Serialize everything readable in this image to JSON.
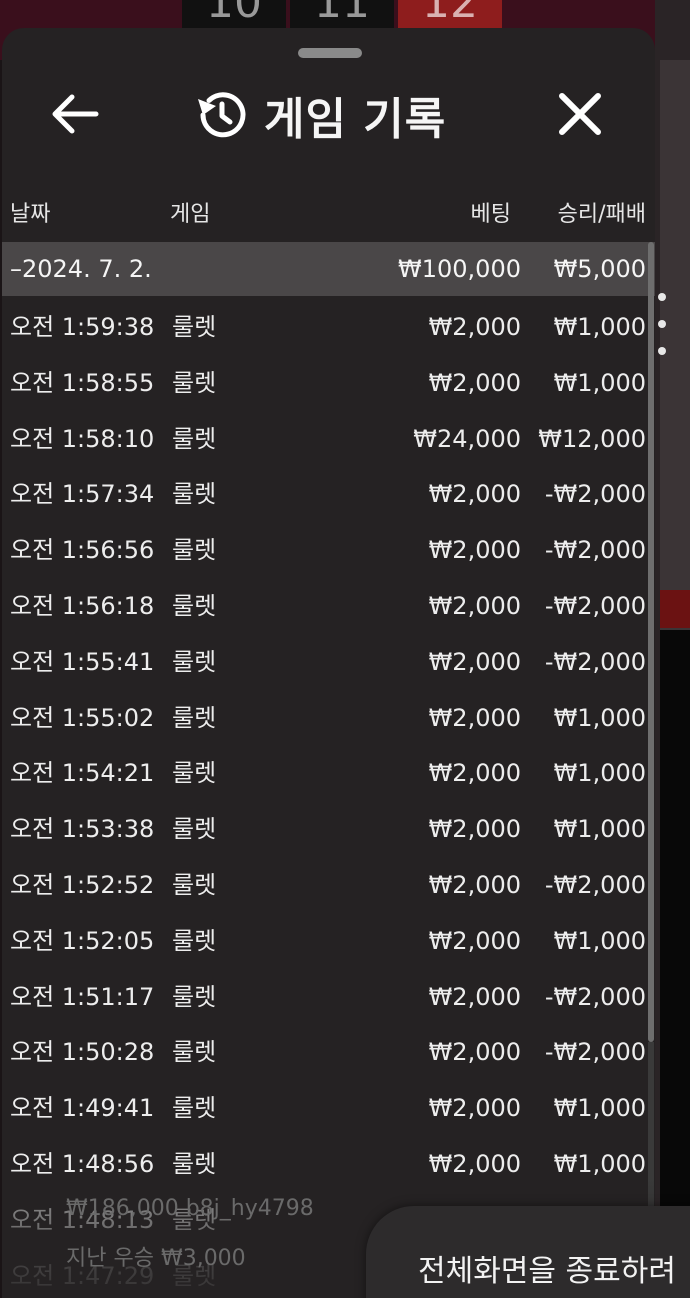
{
  "header": {
    "title": "게임 기록"
  },
  "columns": {
    "date": "날짜",
    "game": "게임",
    "bet": "베팅",
    "result": "승리/패배"
  },
  "summary": {
    "date": "–2024. 7. 2.",
    "bet": "₩100,000",
    "result": "₩5,000"
  },
  "rows": [
    {
      "time": "오전 1:59:38",
      "game": "룰렛",
      "bet": "₩2,000",
      "result": "₩1,000"
    },
    {
      "time": "오전 1:58:55",
      "game": "룰렛",
      "bet": "₩2,000",
      "result": "₩1,000"
    },
    {
      "time": "오전 1:58:10",
      "game": "룰렛",
      "bet": "₩24,000",
      "result": "₩12,000"
    },
    {
      "time": "오전 1:57:34",
      "game": "룰렛",
      "bet": "₩2,000",
      "result": "-₩2,000"
    },
    {
      "time": "오전 1:56:56",
      "game": "룰렛",
      "bet": "₩2,000",
      "result": "-₩2,000"
    },
    {
      "time": "오전 1:56:18",
      "game": "룰렛",
      "bet": "₩2,000",
      "result": "-₩2,000"
    },
    {
      "time": "오전 1:55:41",
      "game": "룰렛",
      "bet": "₩2,000",
      "result": "-₩2,000"
    },
    {
      "time": "오전 1:55:02",
      "game": "룰렛",
      "bet": "₩2,000",
      "result": "₩1,000"
    },
    {
      "time": "오전 1:54:21",
      "game": "룰렛",
      "bet": "₩2,000",
      "result": "₩1,000"
    },
    {
      "time": "오전 1:53:38",
      "game": "룰렛",
      "bet": "₩2,000",
      "result": "₩1,000"
    },
    {
      "time": "오전 1:52:52",
      "game": "룰렛",
      "bet": "₩2,000",
      "result": "-₩2,000"
    },
    {
      "time": "오전 1:52:05",
      "game": "룰렛",
      "bet": "₩2,000",
      "result": "₩1,000"
    },
    {
      "time": "오전 1:51:17",
      "game": "룰렛",
      "bet": "₩2,000",
      "result": "-₩2,000"
    },
    {
      "time": "오전 1:50:28",
      "game": "룰렛",
      "bet": "₩2,000",
      "result": "-₩2,000"
    },
    {
      "time": "오전 1:49:41",
      "game": "룰렛",
      "bet": "₩2,000",
      "result": "₩1,000"
    },
    {
      "time": "오전 1:48:56",
      "game": "룰렛",
      "bet": "₩2,000",
      "result": "₩1,000"
    },
    {
      "time": "오전 1:48:13",
      "game": "룰렛",
      "bet": "",
      "result": ""
    },
    {
      "time": "오전 1:47:29",
      "game": "룰렛",
      "bet": "",
      "result": ""
    }
  ],
  "background": {
    "numbers": [
      "10",
      "11",
      "12"
    ],
    "ghost_line1": "₩186,000 b8j_hy4798",
    "ghost_line2": "지난 우승 ₩3,000"
  },
  "toast": {
    "text": "전체화면을 종료하려"
  }
}
